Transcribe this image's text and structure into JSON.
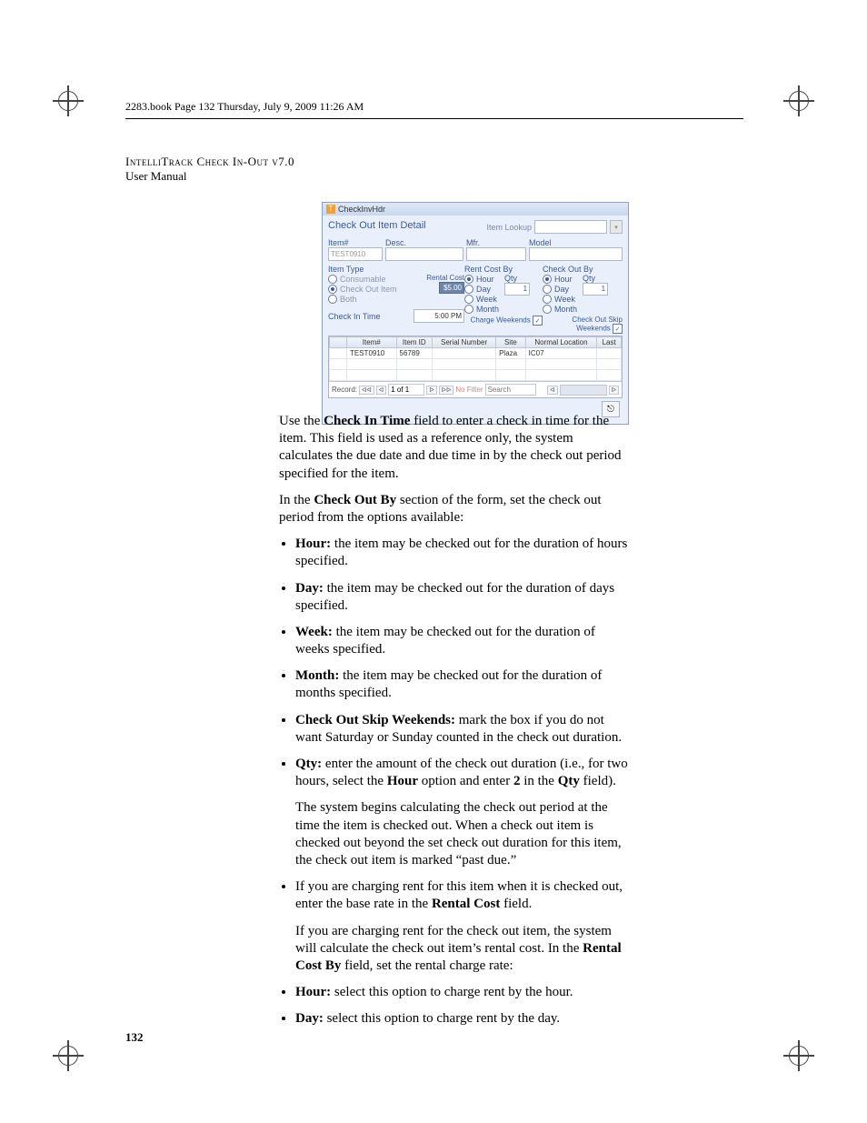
{
  "meta": {
    "header_line": "2283.book  Page 132  Thursday, July 9, 2009  11:26 AM",
    "product": "IntelliTrack Check In-Out v7.0",
    "doc_type": "User Manual",
    "page_number": "132"
  },
  "form": {
    "window_title": "CheckInvHdr",
    "form_title": "Check Out Item Detail",
    "lookup_label": "Item Lookup",
    "fields": {
      "item_no_label": "Item#",
      "item_no_value": "TEST0910",
      "desc_label": "Desc.",
      "mfr_label": "Mfr.",
      "model_label": "Model"
    },
    "item_type": {
      "title": "Item Type",
      "opts": [
        "Consumable",
        "Check Out Item",
        "Both"
      ],
      "selected": "Check Out Item",
      "rental_cost_label": "Rental Cost",
      "rental_cost_value": "$5.00",
      "check_in_time_label": "Check In Time",
      "check_in_time_value": "5:00 PM"
    },
    "rent_cost_by": {
      "title": "Rent Cost By",
      "opts": [
        "Hour",
        "Day",
        "Week",
        "Month"
      ],
      "selected": "Hour",
      "qty_label": "Qty",
      "qty_value": "1",
      "charge_label": "Charge Weekends"
    },
    "check_out_by": {
      "title": "Check Out By",
      "opts": [
        "Hour",
        "Day",
        "Week",
        "Month"
      ],
      "selected": "Hour",
      "qty_label": "Qty",
      "qty_value": "1",
      "skip_label": "Check Out Skip Weekends"
    },
    "grid": {
      "headers": [
        "Item#",
        "Item ID",
        "Serial Number",
        "Site",
        "Normal Location",
        "Last"
      ],
      "row": {
        "item": "TEST0910",
        "id": "56789",
        "serial": "",
        "site": "Plaza",
        "loc": "IC07",
        "last": ""
      }
    },
    "nav": {
      "record_label": "Record:",
      "pos": "1 of 1",
      "nofilter": "No Filter",
      "search": "Search"
    }
  },
  "text": {
    "p1a": "Use the ",
    "p1b": "Check In Time",
    "p1c": " field to enter a check in time for the item. This field is used as a reference only, the system calculates the due date and due time in by the check out period specified for the item.",
    "p2a": "In the ",
    "p2b": "Check Out By",
    "p2c": " section of the form, set the check out period from the options available:",
    "bullets": {
      "hour": {
        "b": "Hour: ",
        "t": "the item may be checked out for the duration of hours specified."
      },
      "day": {
        "b": "Day: ",
        "t": "the item may be checked out for the duration of days specified."
      },
      "week": {
        "b": "Week: ",
        "t": "the item may be checked out for the duration of weeks specified."
      },
      "month": {
        "b": "Month: ",
        "t": "the item may be checked out for the duration of months specified."
      },
      "skip": {
        "b": "Check Out Skip Weekends: ",
        "t": "mark the box if you do not want Saturday or Sunday counted in the check out duration."
      },
      "qty": {
        "b": "Qty: ",
        "t1": "enter the amount of the check out duration (i.e., for two hours, select the ",
        "b2": "Hour",
        "t2": " option and enter ",
        "b3": "2",
        "t3": " in the ",
        "b4": "Qty",
        "t4": " field).",
        "sub": "The system begins calculating the check out period at the time the item is checked out. When a check out item is checked out beyond the set check out duration for this item, the check out item is marked “past due.”"
      },
      "rent": {
        "t1": "If you are charging rent for this item when it is checked out, enter the base rate in the ",
        "b": "Rental Cost",
        "t2": " field.",
        "sub1": "If you are charging rent for the check out item, the system will calculate the check out item’s rental cost. In the ",
        "subB": "Rental Cost By",
        "sub2": " field, set the rental charge rate:"
      },
      "rhour": {
        "b": "Hour: ",
        "t": "select this option to charge rent by the hour."
      },
      "rday": {
        "b": "Day: ",
        "t": "select this option to charge rent by the day."
      }
    }
  }
}
